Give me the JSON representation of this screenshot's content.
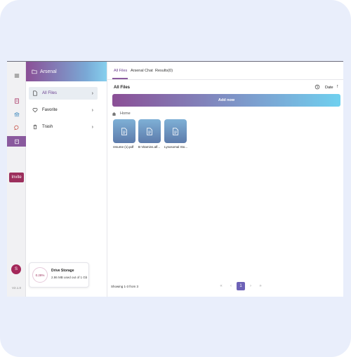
{
  "rail": {
    "menu_icon": "hamburger-icon",
    "items": [
      "files-icon",
      "bank-icon",
      "chat-icon",
      "drive-icon"
    ],
    "invite_label": "Invite",
    "avatar_letter": "S",
    "version": "V2.1.0"
  },
  "sidebar": {
    "title": "Arsenal",
    "items": [
      {
        "label": "All Files",
        "icon": "file-icon",
        "active": true
      },
      {
        "label": "Favorite",
        "icon": "heart-icon",
        "active": false
      },
      {
        "label": "Trash",
        "icon": "trash-icon",
        "active": false
      }
    ],
    "storage": {
      "percent_label": "0.28%",
      "percent": 0.28,
      "title": "Drive Storage",
      "subtitle": "2.86 MB used out of 1 Gb"
    }
  },
  "main": {
    "tabs": [
      {
        "label": "All Files",
        "active": true
      },
      {
        "label": "Arsenal Chat",
        "active": false
      },
      {
        "label": "Results(0)",
        "active": false
      }
    ],
    "title": "All Files",
    "sort_label": "Date",
    "add_label": "Add now",
    "breadcrumb": "Home",
    "files": [
      {
        "name": "resume (1).pdf"
      },
      {
        "name": "B Vitamins.alf..."
      },
      {
        "name": "Lysosomal Sto..."
      }
    ],
    "showing": "Showing 1-3 from 3",
    "pagination": {
      "first": "«",
      "prev": "‹",
      "current": "1",
      "next": "›",
      "last": "»"
    }
  },
  "colors": {
    "accent": "#8a5a9e",
    "invite": "#9c2f5c",
    "page_current": "#6d62b7",
    "frame_bg": "#e9eefb"
  }
}
